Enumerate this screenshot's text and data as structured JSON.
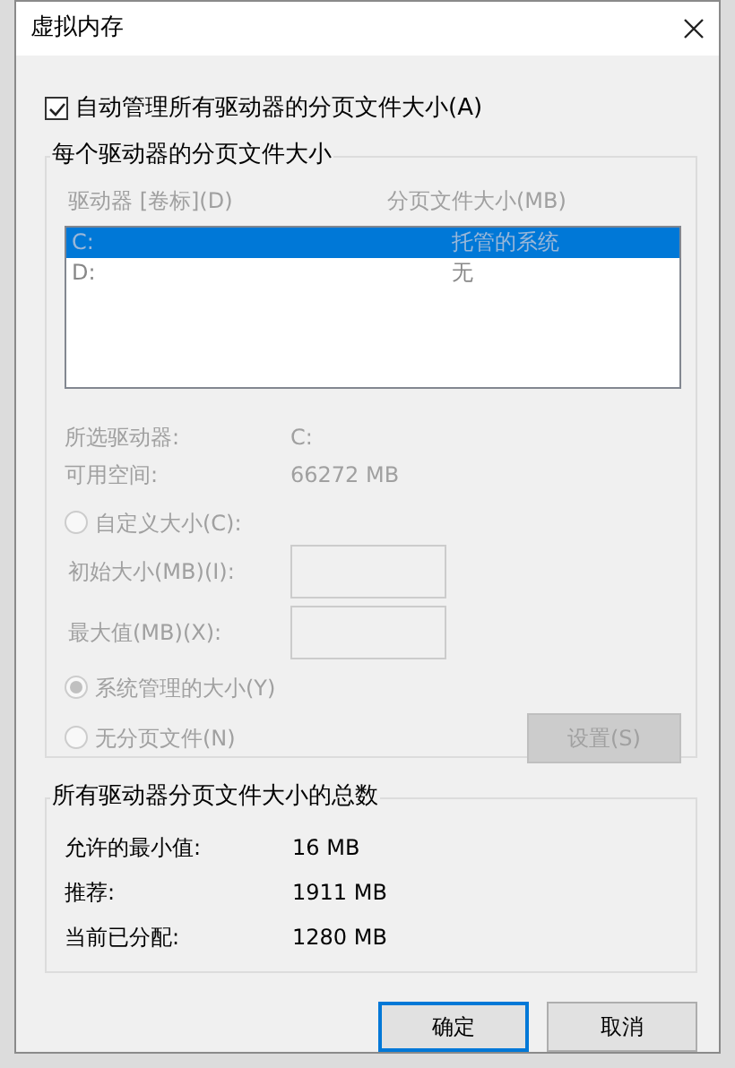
{
  "window": {
    "title": "虚拟内存"
  },
  "auto_manage": {
    "label": "自动管理所有驱动器的分页文件大小(A)",
    "checked": true
  },
  "per_drive": {
    "title": "每个驱动器的分页文件大小",
    "columns": [
      "驱动器 [卷标](D)",
      "分页文件大小(MB)"
    ],
    "drives": [
      {
        "drive": "C:",
        "size": "托管的系统",
        "selected": true
      },
      {
        "drive": "D:",
        "size": "无",
        "selected": false
      }
    ],
    "info": [
      {
        "label": "所选驱动器:",
        "value": "C:"
      },
      {
        "label": "可用空间:",
        "value": "66272 MB"
      }
    ],
    "custom_radio": {
      "label": "自定义大小(C):",
      "selected": false
    },
    "fields": [
      {
        "label": "初始大小(MB)(I):"
      },
      {
        "label": "最大值(MB)(X):"
      }
    ],
    "radios": [
      {
        "label": "系统管理的大小(Y)",
        "selected": true
      },
      {
        "label": "无分页文件(N)",
        "selected": false
      }
    ],
    "set_button": {
      "label": "设置(S)"
    }
  },
  "totals": {
    "title": "所有驱动器分页文件大小的总数",
    "rows": [
      {
        "label": "允许的最小值:",
        "value": "16 MB"
      },
      {
        "label": "推荐:",
        "value": "1911 MB"
      },
      {
        "label": "当前已分配:",
        "value": "1280 MB"
      }
    ]
  },
  "buttons": [
    {
      "label": "确定",
      "default": true
    },
    {
      "label": "取消",
      "default": false
    }
  ]
}
